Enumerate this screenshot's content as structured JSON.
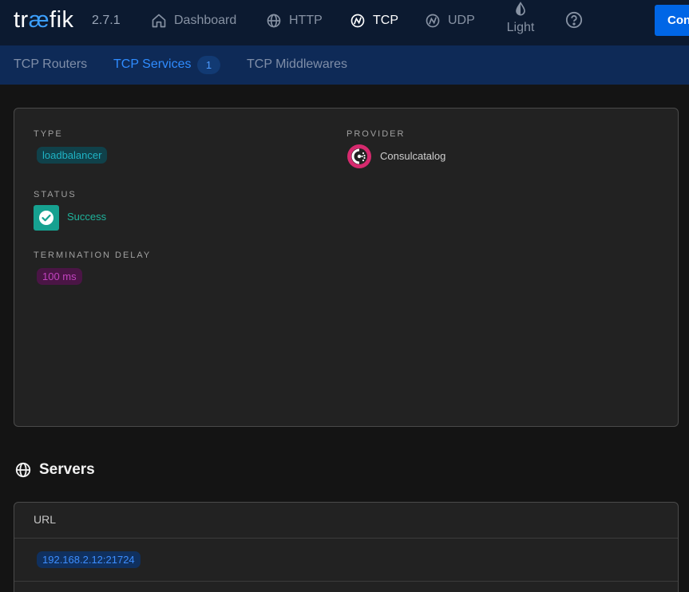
{
  "app": {
    "logo_text_1": "tr",
    "logo_text_ae": "æ",
    "logo_text_2": "fik",
    "version": "2.7.1"
  },
  "nav": {
    "dashboard": "Dashboard",
    "http": "HTTP",
    "tcp": "TCP",
    "udp": "UDP",
    "theme": "Light",
    "connect": "Con"
  },
  "subnav": {
    "routers": "TCP Routers",
    "services": "TCP Services",
    "services_count": "1",
    "middlewares": "TCP Middlewares"
  },
  "details": {
    "type_label": "TYPE",
    "type_value": "loadbalancer",
    "provider_label": "PROVIDER",
    "provider_value": "Consulcatalog",
    "status_label": "STATUS",
    "status_value": "Success",
    "termination_label": "TERMINATION DELAY",
    "termination_value": "100 ms"
  },
  "servers": {
    "title": "Servers",
    "column_url": "URL",
    "rows": [
      "192.168.2.12:21724"
    ]
  },
  "colors": {
    "accent": "#2f8cff",
    "success": "#16a190",
    "provider_brand": "#d62a6e"
  }
}
